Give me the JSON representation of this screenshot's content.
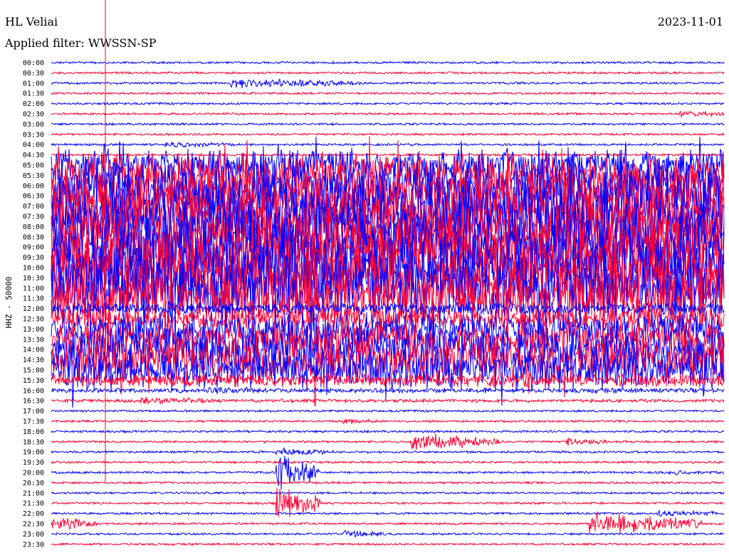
{
  "header": {
    "station": "HL Veliai",
    "date": "2023-11-01",
    "filter_prefix": "Applied filter:",
    "filter_name": "WWSSN-SP"
  },
  "chart_data": {
    "type": "line",
    "title": "HL Veliai",
    "subtitle": "Applied filter: WWSSN-SP",
    "ylabel": "HHZ - 50000",
    "xlabel": "",
    "grid": false,
    "legend": "none",
    "series_colors": [
      "#0000ff",
      "#ff0033"
    ],
    "marker_color": "#ff0000",
    "time_ticks": [
      "00:00",
      "00:30",
      "01:00",
      "01:30",
      "02:00",
      "02:30",
      "03:00",
      "03:30",
      "04:00",
      "04:30",
      "05:00",
      "05:30",
      "06:00",
      "06:30",
      "07:00",
      "07:30",
      "08:00",
      "08:30",
      "09:00",
      "09:30",
      "10:00",
      "10:30",
      "11:00",
      "11:30",
      "12:00",
      "12:30",
      "13:00",
      "13:30",
      "14:00",
      "14:30",
      "15:00",
      "15:30",
      "16:00",
      "16:30",
      "17:00",
      "17:30",
      "18:00",
      "18:30",
      "19:00",
      "19:30",
      "20:00",
      "20:30",
      "21:00",
      "21:30",
      "22:00",
      "22:30",
      "23:00",
      "23:30"
    ],
    "trace_minutes": 30,
    "noise_level": [
      1,
      1,
      1,
      1,
      1,
      1,
      1,
      1,
      1,
      1,
      26,
      34,
      40,
      45,
      48,
      50,
      50,
      50,
      50,
      50,
      50,
      50,
      50,
      46,
      10,
      18,
      26,
      28,
      34,
      36,
      32,
      10,
      3,
      2,
      1,
      1,
      1,
      1,
      1,
      1,
      1,
      1,
      1,
      1,
      1,
      1,
      1,
      1
    ],
    "events": [
      {
        "trace": 2,
        "minute": 8,
        "amplitude": 8,
        "duration": 6
      },
      {
        "trace": 5,
        "minute": 28,
        "amplitude": 5,
        "duration": 3
      },
      {
        "trace": 8,
        "minute": 5,
        "amplitude": 5,
        "duration": 4
      },
      {
        "trace": 32,
        "minute": 7,
        "amplitude": 6,
        "duration": 5
      },
      {
        "trace": 33,
        "minute": 4,
        "amplitude": 7,
        "duration": 4
      },
      {
        "trace": 35,
        "minute": 13,
        "amplitude": 5,
        "duration": 2
      },
      {
        "trace": 37,
        "minute": 16,
        "amplitude": 14,
        "duration": 4
      },
      {
        "trace": 37,
        "minute": 23,
        "amplitude": 6,
        "duration": 2
      },
      {
        "trace": 38,
        "minute": 10,
        "amplitude": 6,
        "duration": 3
      },
      {
        "trace": 40,
        "minute": 10,
        "amplitude": 30,
        "duration": 2
      },
      {
        "trace": 40,
        "minute": 27,
        "amplitude": 5,
        "duration": 3
      },
      {
        "trace": 43,
        "minute": 10,
        "amplitude": 30,
        "duration": 2
      },
      {
        "trace": 44,
        "minute": 27,
        "amplitude": 6,
        "duration": 3
      },
      {
        "trace": 45,
        "minute": 0,
        "amplitude": 12,
        "duration": 2
      },
      {
        "trace": 45,
        "minute": 24,
        "amplitude": 18,
        "duration": 5
      },
      {
        "trace": 46,
        "minute": 13,
        "amplitude": 6,
        "duration": 2
      }
    ]
  }
}
